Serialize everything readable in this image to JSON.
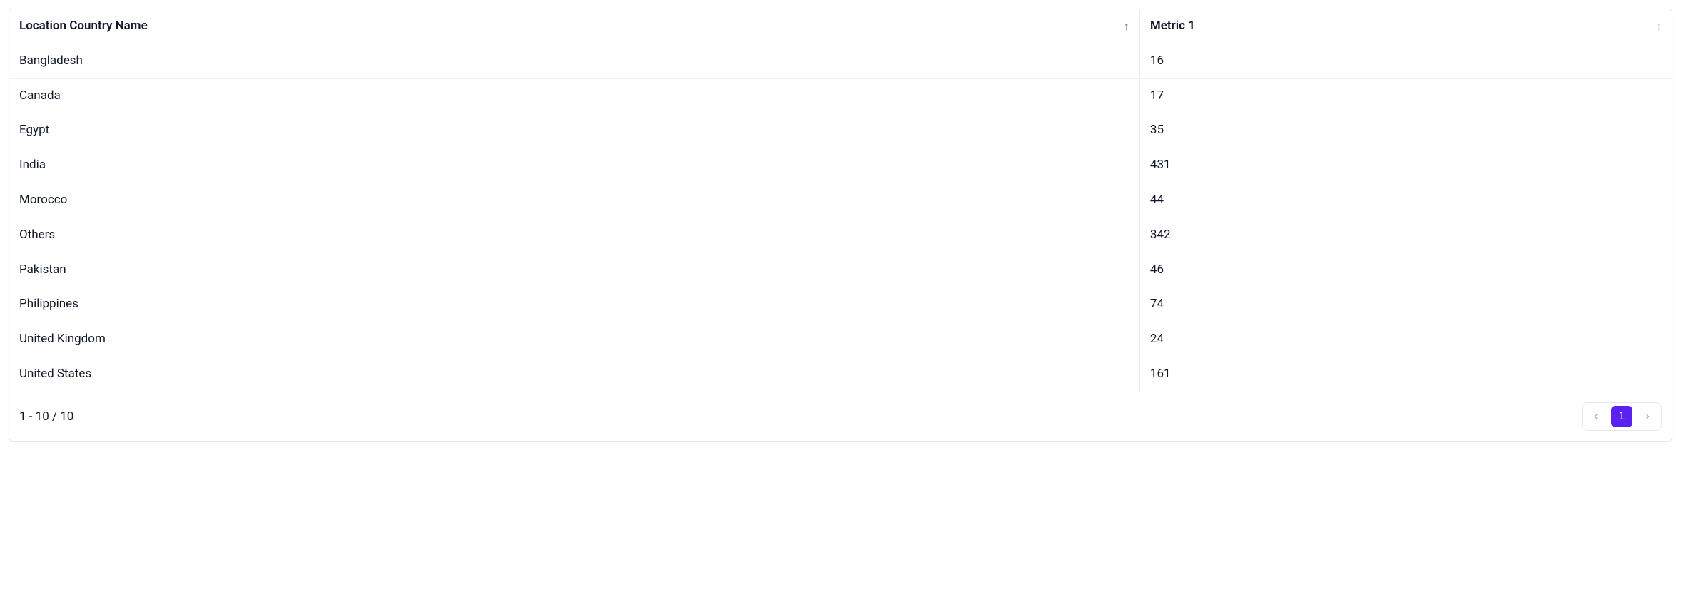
{
  "table": {
    "columns": [
      {
        "label": "Location Country Name",
        "sort": "asc"
      },
      {
        "label": "Metric 1",
        "sort": "none"
      }
    ],
    "rows": [
      {
        "name": "Bangladesh",
        "metric": "16"
      },
      {
        "name": "Canada",
        "metric": "17"
      },
      {
        "name": "Egypt",
        "metric": "35"
      },
      {
        "name": "India",
        "metric": "431"
      },
      {
        "name": "Morocco",
        "metric": "44"
      },
      {
        "name": "Others",
        "metric": "342"
      },
      {
        "name": "Pakistan",
        "metric": "46"
      },
      {
        "name": "Philippines",
        "metric": "74"
      },
      {
        "name": "United Kingdom",
        "metric": "24"
      },
      {
        "name": "United States",
        "metric": "161"
      }
    ]
  },
  "footer": {
    "range_text": "1 - 10 / 10",
    "current_page_label": "1"
  }
}
